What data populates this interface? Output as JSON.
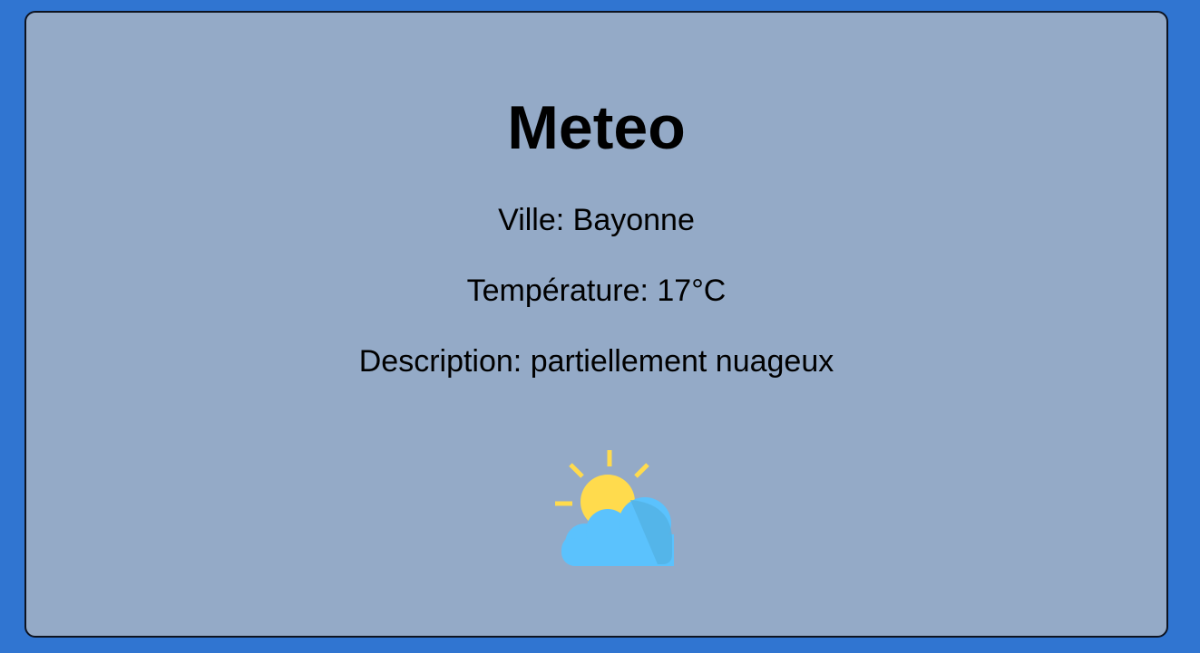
{
  "header": {
    "title": "Meteo"
  },
  "weather": {
    "city_line": "Ville: Bayonne",
    "temperature_line": "Température: 17°C",
    "description_line": "Description: partiellement nuageux",
    "icon": "partly-cloudy-icon"
  },
  "colors": {
    "page_background": "#3075d1",
    "card_background": "#94aac7",
    "sun": "#ffdb4d",
    "cloud": "#5bc2fd"
  }
}
